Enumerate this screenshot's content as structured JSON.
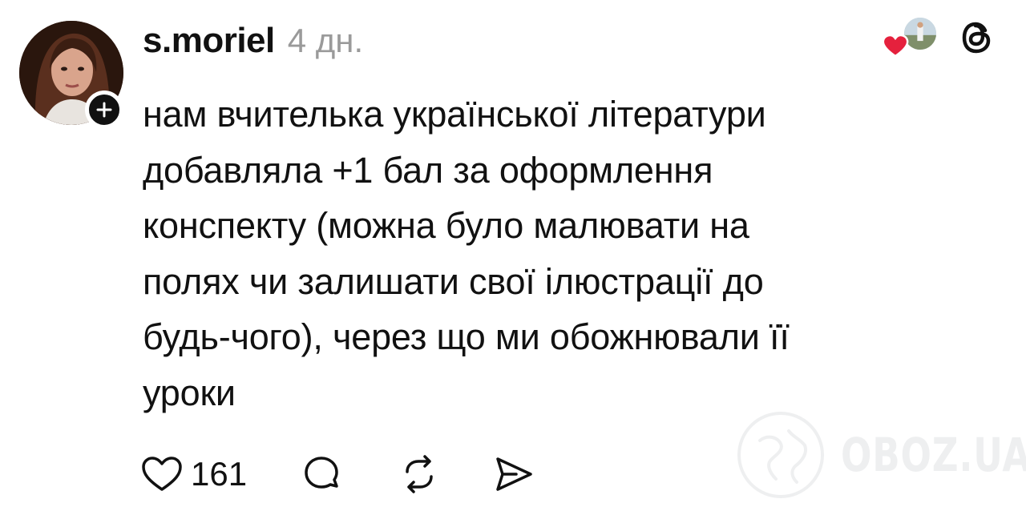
{
  "post": {
    "author": {
      "username": "s.moriel",
      "avatar_icon": "user-avatar-photo",
      "follow_icon": "plus-icon"
    },
    "timestamp": "4 дн.",
    "liked_by_icon": "liked-by-avatar",
    "liked_heart_color": "#e5213d",
    "app_icon": "threads-logo-icon",
    "text_lines": [
      "нам вчителька української літератури",
      "добавляла +1 бал за оформлення",
      "конспекту (можна було малювати на",
      "полях чи залишати свої ілюстрації до",
      "будь-чого), через що ми обожнювали її",
      "уроки"
    ],
    "actions": {
      "like_icon": "heart-outline-icon",
      "like_count": "161",
      "reply_icon": "comment-icon",
      "repost_icon": "repost-icon",
      "share_icon": "send-icon"
    }
  },
  "watermark": {
    "text": "OBOZ.UA",
    "icon": "globe-icon",
    "color": "#9aa0a6"
  }
}
